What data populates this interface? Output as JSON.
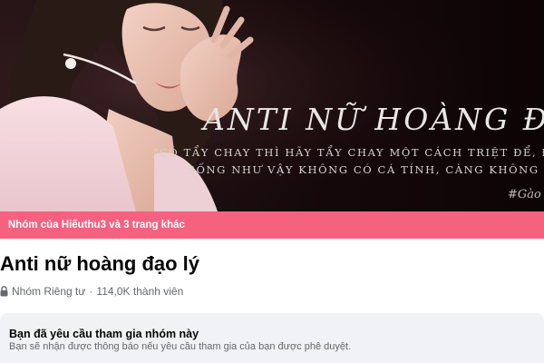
{
  "cover": {
    "title": "ANTI NỮ HOÀNG ĐẠO",
    "quote_line1": "\"CÓ TẨY CHAY THÌ HÃY TẨY CHAY MỘT CÁCH TRIỆT ĐỂ, ĐỪNG TẨY CH",
    "quote_line2": "SỐNG NHƯ VẬY KHÔNG CÓ CÁ TÍNH, CÀNG KHÔNG CÓ CHÍNH",
    "hashtag": "#Gào"
  },
  "banner": {
    "text": "Nhóm của Hiếuthu3 và 3 trang khác"
  },
  "group": {
    "name": "Anti nữ hoàng đạo lý",
    "privacy": "Nhóm Riêng tư",
    "separator": "·",
    "members": "114,0K thành viên"
  },
  "request": {
    "title": "Bạn đã yêu cầu tham gia nhóm này",
    "description": "Bạn sẽ nhận được thông báo nếu yêu cầu tham gia của bạn được phê duyệt."
  },
  "icons": {
    "privacy": "lock-icon"
  },
  "colors": {
    "banner": "#f4627f",
    "request_bg": "#f0f2f5",
    "meta_text": "#65676b"
  }
}
